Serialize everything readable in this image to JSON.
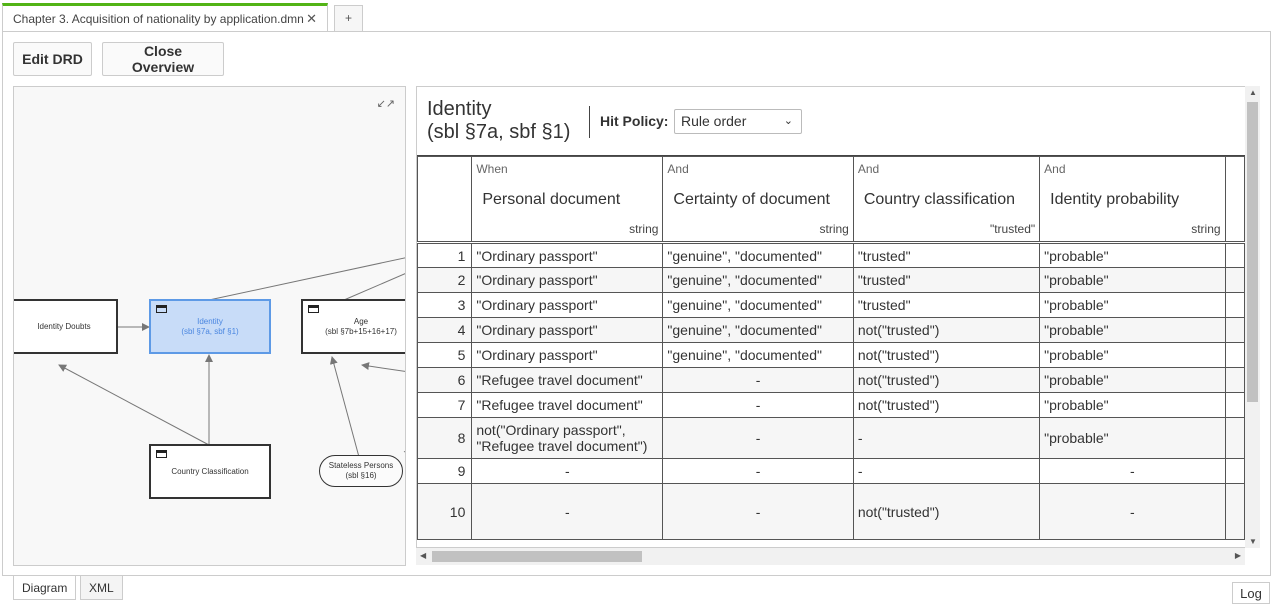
{
  "tabs": {
    "file_tab": "Chapter 3. Acquisition of nationality by application.dmn",
    "close_glyph": "✕",
    "add_tab": "+"
  },
  "toolbar": {
    "edit_drd": "Edit DRD",
    "close_overview": "Close Overview"
  },
  "diagram": {
    "collapse_icon": "collapse-icon",
    "nodes": {
      "identity_doubts": "Identity Doubts",
      "identity": "Identity",
      "identity_sub": "(sbl §7a, sbf §1)",
      "age": "Age",
      "age_sub": "(sbl §7b+15+16+17)",
      "country_classification": "Country Classification",
      "stateless": "Stateless Persons",
      "stateless_sub": "(sbl §16)"
    }
  },
  "decision_table": {
    "title_line1": "Identity",
    "title_line2": "(sbl §7a, sbf §1)",
    "hit_policy_label": "Hit Policy:",
    "hit_policy_value": "Rule order",
    "columns": [
      {
        "clause": "When",
        "label": "Personal document",
        "type": "string"
      },
      {
        "clause": "And",
        "label": "Certainty of document",
        "type": "string"
      },
      {
        "clause": "And",
        "label": "Country classification",
        "type": "\"trusted\""
      },
      {
        "clause": "And",
        "label": "Identity probability",
        "type": "string"
      }
    ],
    "rows": [
      {
        "n": "1",
        "c1": "\"Ordinary passport\"",
        "c2": "\"genuine\", \"documented\"",
        "c3": "\"trusted\"",
        "c4": "\"probable\""
      },
      {
        "n": "2",
        "c1": "\"Ordinary passport\"",
        "c2": "\"genuine\", \"documented\"",
        "c3": "\"trusted\"",
        "c4": "\"probable\""
      },
      {
        "n": "3",
        "c1": "\"Ordinary passport\"",
        "c2": "\"genuine\", \"documented\"",
        "c3": "\"trusted\"",
        "c4": "\"probable\""
      },
      {
        "n": "4",
        "c1": "\"Ordinary passport\"",
        "c2": "\"genuine\", \"documented\"",
        "c3": "not(\"trusted\")",
        "c4": "\"probable\""
      },
      {
        "n": "5",
        "c1": "\"Ordinary passport\"",
        "c2": "\"genuine\", \"documented\"",
        "c3": "not(\"trusted\")",
        "c4": "\"probable\""
      },
      {
        "n": "6",
        "c1": "\"Refugee travel document\"",
        "c2": "-",
        "c3": "not(\"trusted\")",
        "c4": "\"probable\""
      },
      {
        "n": "7",
        "c1": "\"Refugee travel document\"",
        "c2": "-",
        "c3": "not(\"trusted\")",
        "c4": "\"probable\""
      },
      {
        "n": "8",
        "c1": "not(\"Ordinary passport\", \"Refugee travel document\")",
        "c2": "-",
        "c3": "-",
        "c4": "\"probable\""
      },
      {
        "n": "9",
        "c1": "-",
        "c2": "-",
        "c3": "-",
        "c4": "-"
      },
      {
        "n": "10",
        "c1": "-",
        "c2": "-",
        "c3": "not(\"trusted\")",
        "c4": "-"
      }
    ]
  },
  "bottom_tabs": {
    "diagram": "Diagram",
    "xml": "XML"
  },
  "log_button": "Log"
}
